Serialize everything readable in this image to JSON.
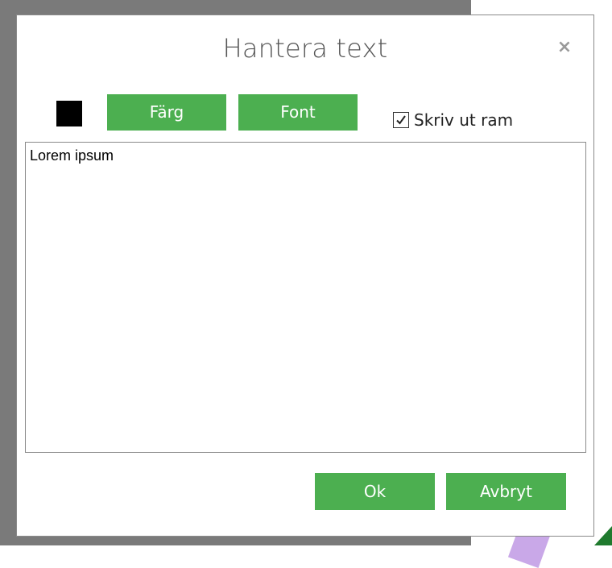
{
  "dialog": {
    "title": "Hantera text",
    "close_symbol": "×"
  },
  "toolbar": {
    "swatch_color": "#000000",
    "color_button_label": "Färg",
    "font_button_label": "Font",
    "print_frame_checkbox": {
      "label": "Skriv ut ram",
      "checked": true
    }
  },
  "editor": {
    "value": "Lorem ipsum"
  },
  "footer": {
    "ok_label": "Ok",
    "cancel_label": "Avbryt"
  },
  "colors": {
    "button_green": "#4caf50",
    "backdrop_gray": "#7a7a7a"
  }
}
